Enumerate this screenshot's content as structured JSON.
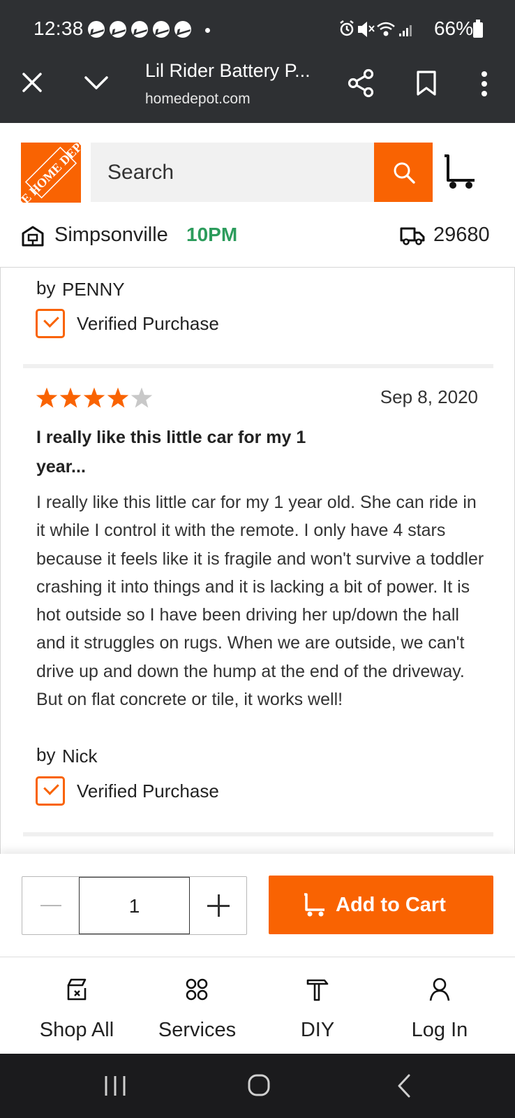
{
  "status_bar": {
    "time": "12:38",
    "battery": "66%"
  },
  "browser": {
    "page_title": "Lil Rider Battery P...",
    "url": "homedepot.com"
  },
  "header": {
    "logo_text": "THE HOME DEPOT",
    "search_placeholder": "Search",
    "store_name": "Simpsonville",
    "store_hours": "10PM",
    "zip_code": "29680"
  },
  "reviews": {
    "previous": {
      "author_prefix": "by",
      "author": "PENNY",
      "verified_label": "Verified Purchase"
    },
    "current": {
      "rating": 4,
      "max_rating": 5,
      "date": "Sep 8, 2020",
      "title": "I really like this little car for my 1 year...",
      "body": "I really like this little car for my 1 year old. She can ride in it while I control it with the remote. I only have 4 stars because it feels like it is fragile and won't survive a toddler crashing it into things and it is lacking a bit of power. It is hot outside so I have been driving her up/down the hall and it struggles on rugs. When we are outside, we can't drive up and down the hump at the end of the driveway. But on flat concrete or tile, it works well!",
      "author_prefix": "by",
      "author": "Nick",
      "verified_label": "Verified Purchase"
    }
  },
  "cart_bar": {
    "quantity": "1",
    "add_to_cart_label": "Add to Cart"
  },
  "bottom_nav": {
    "items": [
      {
        "label": "Shop All",
        "icon": "shop-all-icon"
      },
      {
        "label": "Services",
        "icon": "services-icon"
      },
      {
        "label": "DIY",
        "icon": "diy-hammer-icon"
      },
      {
        "label": "Log In",
        "icon": "user-icon"
      }
    ]
  },
  "colors": {
    "brand_orange": "#f96302",
    "store_hours_green": "#2c9c5c",
    "chrome_dark": "#2e3033"
  }
}
